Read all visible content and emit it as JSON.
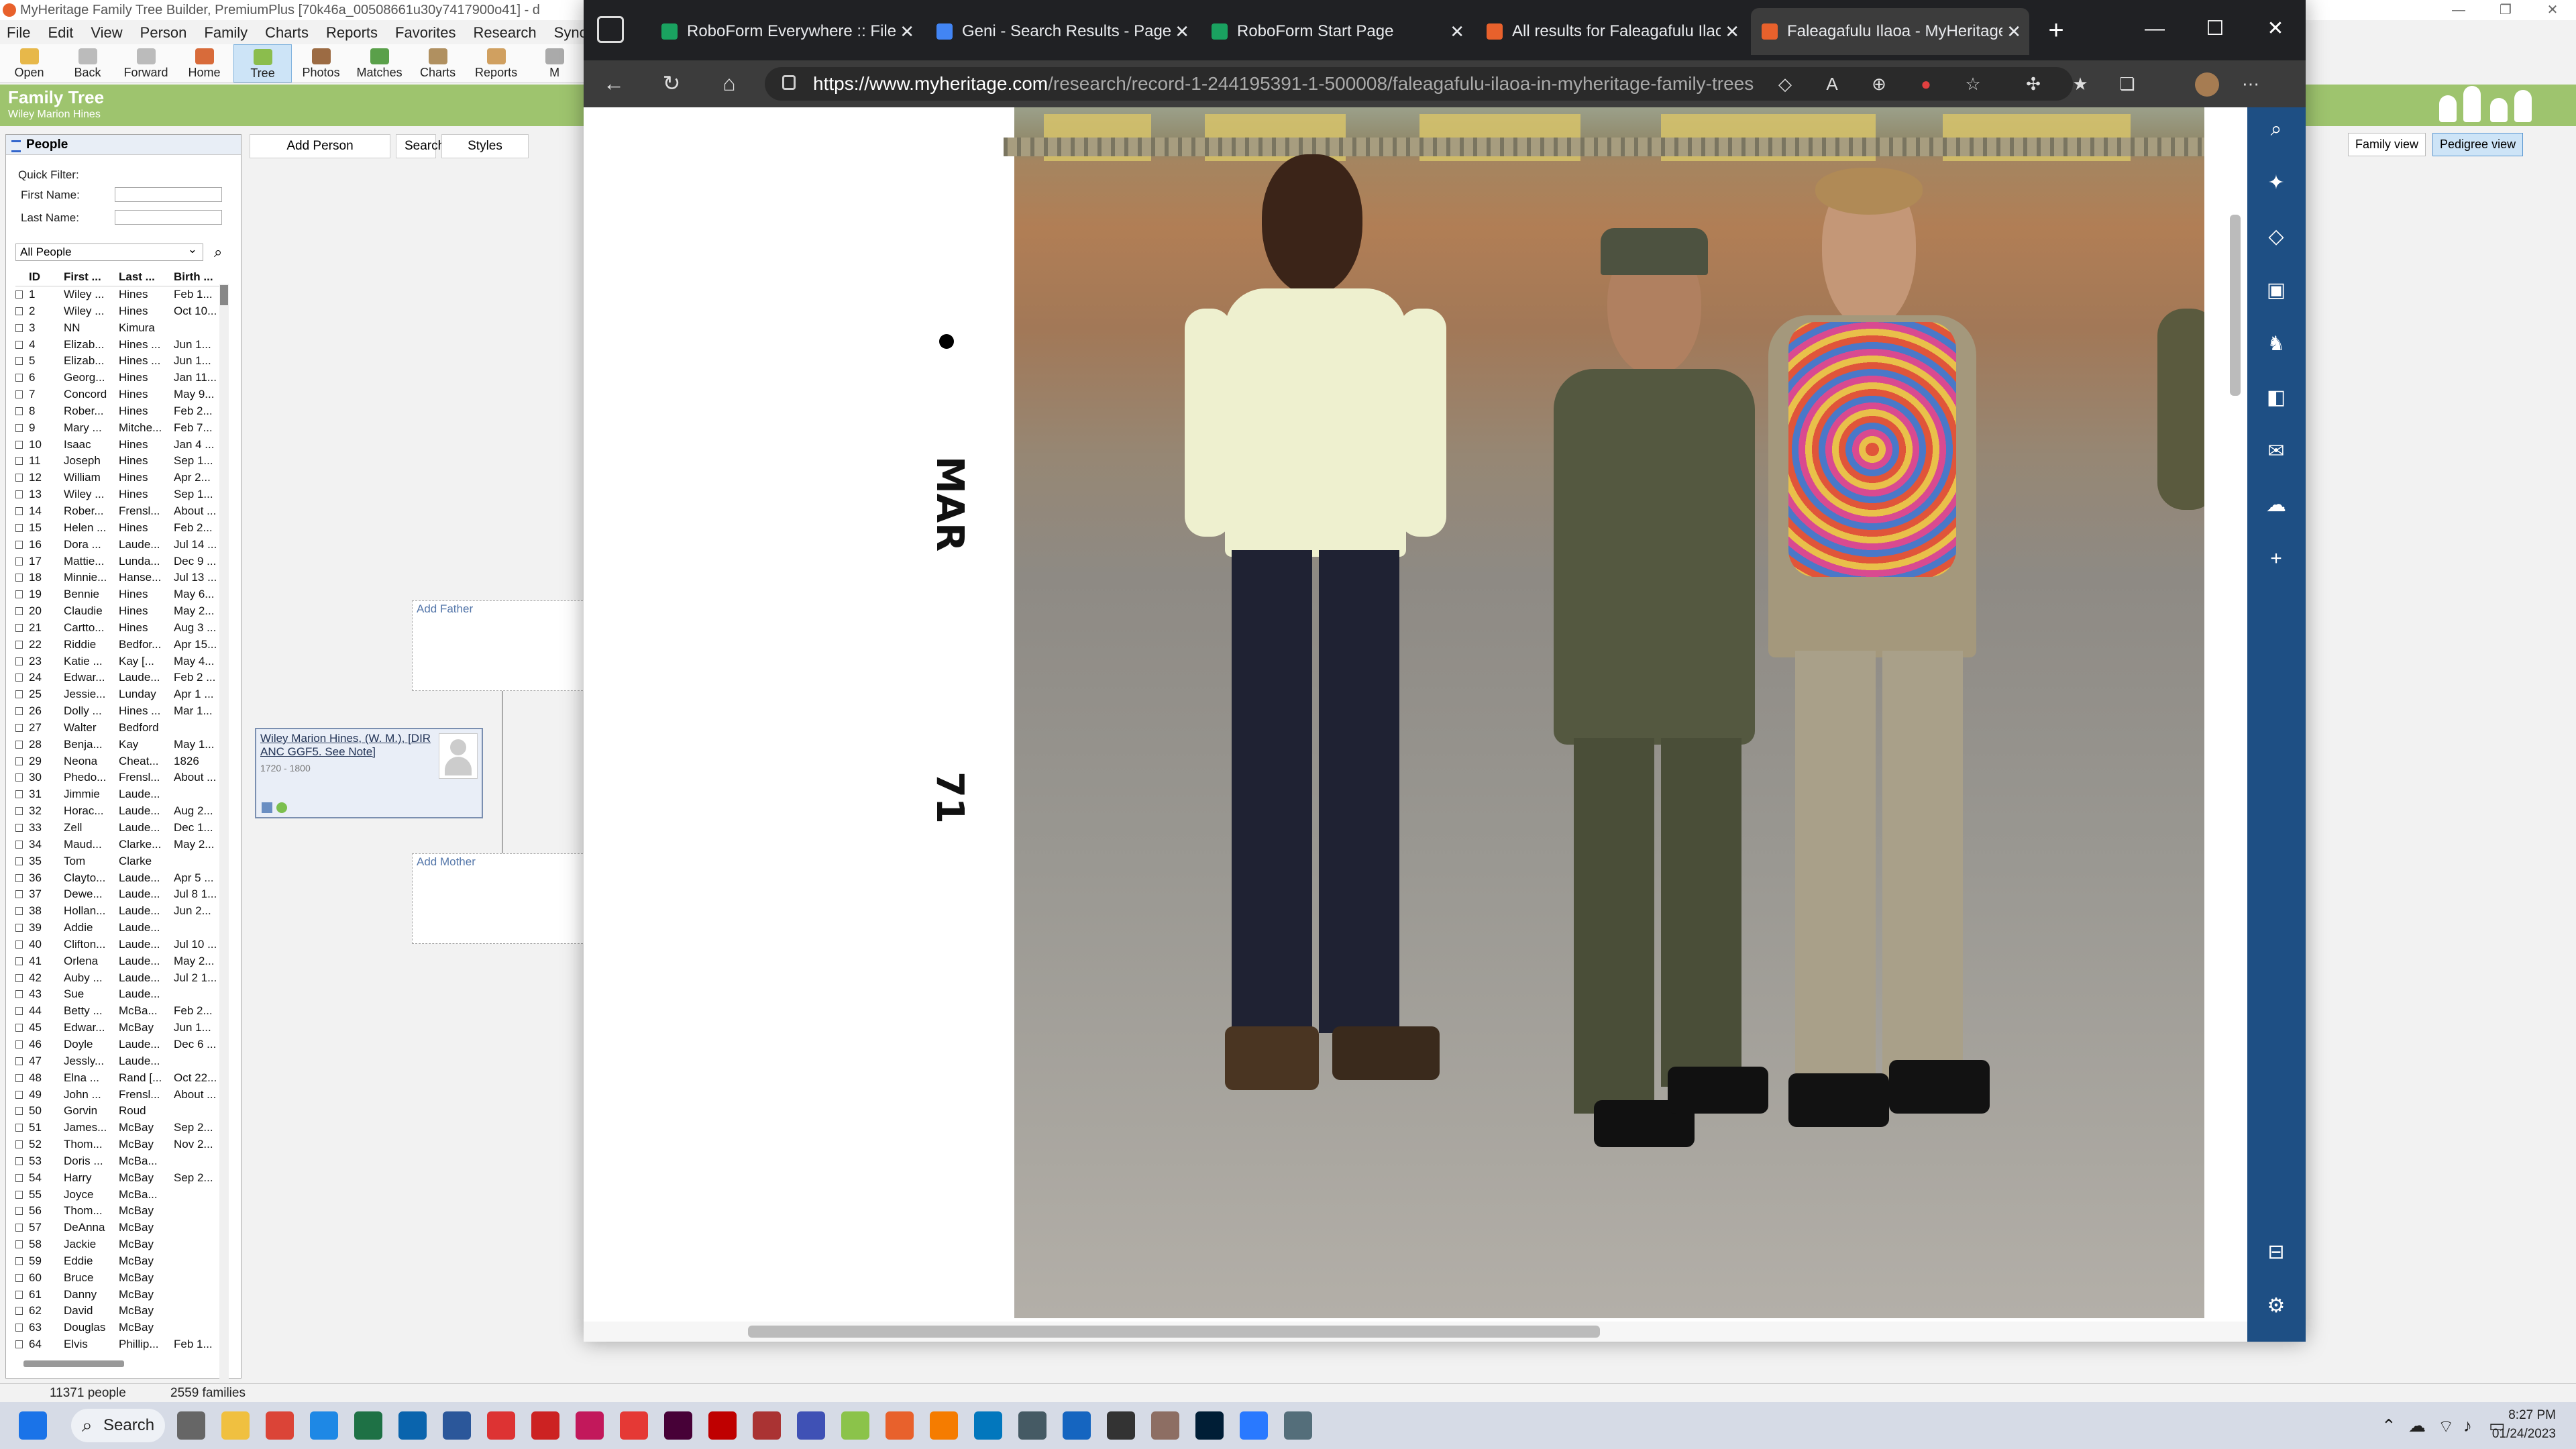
{
  "app": {
    "title": "MyHeritage Family Tree Builder, PremiumPlus [70k46a_00508661u30y7417900o41] - d",
    "menu": [
      "File",
      "Edit",
      "View",
      "Person",
      "Family",
      "Charts",
      "Reports",
      "Favorites",
      "Research",
      "Sync (publis"
    ],
    "toolbar": [
      "Open",
      "Back",
      "Forward",
      "Home",
      "Tree",
      "Photos",
      "Matches",
      "Charts",
      "Reports",
      "M"
    ],
    "section_title": "Family Tree",
    "section_sub": "Wiley Marion Hines",
    "views": {
      "family": "Family view",
      "pedigree": "Pedigree view"
    }
  },
  "people_panel": {
    "title": "People",
    "quick_filter": "Quick Filter:",
    "first_name": "First Name:",
    "last_name": "Last Name:",
    "filter_select": "All People",
    "columns": [
      "ID",
      "First ...",
      "Last ...",
      "Birth ..."
    ],
    "rows": [
      [
        "1",
        "Wiley ...",
        "Hines",
        "Feb 1..."
      ],
      [
        "2",
        "Wiley ...",
        "Hines",
        "Oct 10..."
      ],
      [
        "3",
        "NN",
        "Kimura",
        ""
      ],
      [
        "4",
        "Elizab...",
        "Hines ...",
        "Jun 1..."
      ],
      [
        "5",
        "Elizab...",
        "Hines ...",
        "Jun 1..."
      ],
      [
        "6",
        "Georg...",
        "Hines",
        "Jan 11..."
      ],
      [
        "7",
        "Concord",
        "Hines",
        "May 9..."
      ],
      [
        "8",
        "Rober...",
        "Hines",
        "Feb 2..."
      ],
      [
        "9",
        "Mary ...",
        "Mitche...",
        "Feb 7..."
      ],
      [
        "10",
        "Isaac",
        "Hines",
        "Jan 4 ..."
      ],
      [
        "11",
        "Joseph",
        "Hines",
        "Sep 1..."
      ],
      [
        "12",
        "William",
        "Hines",
        "Apr 2..."
      ],
      [
        "13",
        "Wiley ...",
        "Hines",
        "Sep 1..."
      ],
      [
        "14",
        "Rober...",
        "Frensl...",
        "About ..."
      ],
      [
        "15",
        "Helen ...",
        "Hines",
        "Feb 2..."
      ],
      [
        "16",
        "Dora ...",
        "Laude...",
        "Jul 14 ..."
      ],
      [
        "17",
        "Mattie...",
        "Lunda...",
        "Dec 9 ..."
      ],
      [
        "18",
        "Minnie...",
        "Hanse...",
        "Jul 13 ..."
      ],
      [
        "19",
        "Bennie",
        "Hines",
        "May 6..."
      ],
      [
        "20",
        "Claudie",
        "Hines",
        "May 2..."
      ],
      [
        "21",
        "Cartto...",
        "Hines",
        "Aug 3 ..."
      ],
      [
        "22",
        "Riddie",
        "Bedfor...",
        "Apr 15..."
      ],
      [
        "23",
        "Katie ...",
        "Kay [...",
        "May 4..."
      ],
      [
        "24",
        "Edwar...",
        "Laude...",
        "Feb 2 ..."
      ],
      [
        "25",
        "Jessie...",
        "Lunday",
        "Apr 1 ..."
      ],
      [
        "26",
        "Dolly ...",
        "Hines ...",
        "Mar 1..."
      ],
      [
        "27",
        "Walter",
        "Bedford",
        ""
      ],
      [
        "28",
        "Benja...",
        "Kay",
        "May 1..."
      ],
      [
        "29",
        "Neona",
        "Cheat...",
        "1826"
      ],
      [
        "30",
        "Phedo...",
        "Frensl...",
        "About ..."
      ],
      [
        "31",
        "Jimmie",
        "Laude...",
        ""
      ],
      [
        "32",
        "Horac...",
        "Laude...",
        "Aug 2..."
      ],
      [
        "33",
        "Zell",
        "Laude...",
        "Dec 1..."
      ],
      [
        "34",
        "Maud...",
        "Clarke...",
        "May 2..."
      ],
      [
        "35",
        "Tom",
        "Clarke",
        ""
      ],
      [
        "36",
        "Clayto...",
        "Laude...",
        "Apr 5 ..."
      ],
      [
        "37",
        "Dewe...",
        "Laude...",
        "Jul 8 1..."
      ],
      [
        "38",
        "Hollan...",
        "Laude...",
        "Jun 2..."
      ],
      [
        "39",
        "Addie",
        "Laude...",
        ""
      ],
      [
        "40",
        "Clifton...",
        "Laude...",
        "Jul 10 ..."
      ],
      [
        "41",
        "Orlena",
        "Laude...",
        "May 2..."
      ],
      [
        "42",
        "Auby ...",
        "Laude...",
        "Jul 2 1..."
      ],
      [
        "43",
        "Sue",
        "Laude...",
        ""
      ],
      [
        "44",
        "Betty ...",
        "McBa...",
        "Feb 2..."
      ],
      [
        "45",
        "Edwar...",
        "McBay",
        "Jun 1..."
      ],
      [
        "46",
        "Doyle",
        "Laude...",
        "Dec 6 ..."
      ],
      [
        "47",
        "Jessly...",
        "Laude...",
        ""
      ],
      [
        "48",
        "Elna ...",
        "Rand [...",
        "Oct 22..."
      ],
      [
        "49",
        "John ...",
        "Frensl...",
        "About ..."
      ],
      [
        "50",
        "Gorvin",
        "Roud",
        ""
      ],
      [
        "51",
        "James...",
        "McBay",
        "Sep 2..."
      ],
      [
        "52",
        "Thom...",
        "McBay",
        "Nov 2..."
      ],
      [
        "53",
        "Doris ...",
        "McBa...",
        ""
      ],
      [
        "54",
        "Harry",
        "McBay",
        "Sep 2..."
      ],
      [
        "55",
        "Joyce",
        "McBa...",
        ""
      ],
      [
        "56",
        "Thom...",
        "McBay",
        ""
      ],
      [
        "57",
        "DeAnna",
        "McBay",
        ""
      ],
      [
        "58",
        "Jackie",
        "McBay",
        ""
      ],
      [
        "59",
        "Eddie",
        "McBay",
        ""
      ],
      [
        "60",
        "Bruce",
        "McBay",
        ""
      ],
      [
        "61",
        "Danny",
        "McBay",
        ""
      ],
      [
        "62",
        "David",
        "McBay",
        ""
      ],
      [
        "63",
        "Douglas",
        "McBay",
        ""
      ],
      [
        "64",
        "Elvis",
        "Phillip...",
        "Feb 1..."
      ]
    ]
  },
  "tree": {
    "toolbar": [
      "Add Person",
      "Search",
      "Styles"
    ],
    "add_father": "Add Father",
    "add_mother": "Add Mother",
    "person_name": "Wiley Marion Hines, (W. M.), [DIR ANC GGF5. See Note]",
    "person_dates": "1720 - 1800",
    "add_photo": "Add photo"
  },
  "status": {
    "people": "11371 people",
    "families": "2559 families"
  },
  "browser": {
    "tabs": [
      {
        "label": "RoboForm Everywhere :: Files",
        "color": "#1aa260"
      },
      {
        "label": "Geni - Search Results - Page",
        "color": "#4285f4"
      },
      {
        "label": "RoboForm Start Page",
        "color": "#1aa260"
      },
      {
        "label": "All results for Faleagafulu Ilao",
        "color": "#e8612c"
      },
      {
        "label": "Faleagafulu Ilaoa - MyHeritage",
        "color": "#e8612c"
      }
    ],
    "url_host": "https://www.myheritage.com",
    "url_path": "/research/record-1-244195391-1-500008/faleagafulu-ilaoa-in-myheritage-family-trees"
  },
  "photo": {
    "film_text_1": "MAR",
    "film_text_2": "71"
  },
  "taskbar": {
    "search": "Search",
    "time": "8:27 PM",
    "date": "01/24/2023"
  }
}
